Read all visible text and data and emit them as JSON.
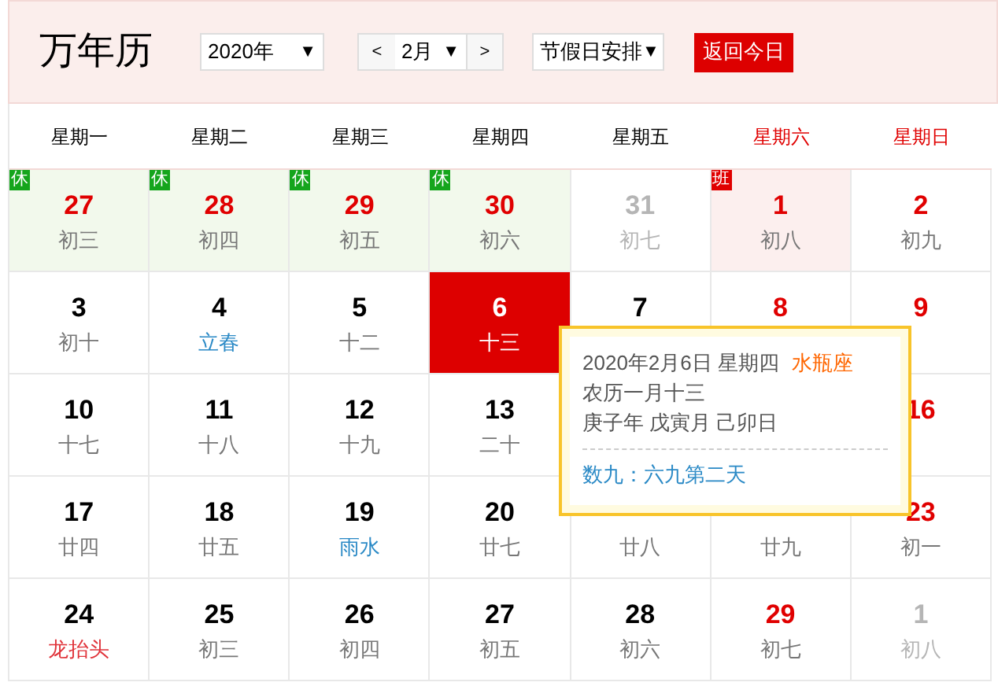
{
  "title": "万年历",
  "year_select": {
    "value": "2020年",
    "caret": "▼"
  },
  "month_select": {
    "prev": "<",
    "value": "2月",
    "caret": "▼",
    "next": ">"
  },
  "holiday_select": {
    "value": "节假日安排",
    "caret": "▼"
  },
  "today_button": "返回今日",
  "weekdays": [
    {
      "label": "星期一",
      "weekend": false
    },
    {
      "label": "星期二",
      "weekend": false
    },
    {
      "label": "星期三",
      "weekend": false
    },
    {
      "label": "星期四",
      "weekend": false
    },
    {
      "label": "星期五",
      "weekend": false
    },
    {
      "label": "星期六",
      "weekend": true
    },
    {
      "label": "星期日",
      "weekend": true
    }
  ],
  "cells": [
    {
      "date": "27",
      "kind": "rest",
      "lunar": {
        "text": "初三",
        "kind": "plain"
      },
      "badge": {
        "label": "休",
        "kind": "rest"
      },
      "selected": false
    },
    {
      "date": "28",
      "kind": "rest",
      "lunar": {
        "text": "初四",
        "kind": "plain"
      },
      "badge": {
        "label": "休",
        "kind": "rest"
      },
      "selected": false
    },
    {
      "date": "29",
      "kind": "rest",
      "lunar": {
        "text": "初五",
        "kind": "plain"
      },
      "badge": {
        "label": "休",
        "kind": "rest"
      },
      "selected": false
    },
    {
      "date": "30",
      "kind": "rest",
      "lunar": {
        "text": "初六",
        "kind": "plain"
      },
      "badge": {
        "label": "休",
        "kind": "rest"
      },
      "selected": false
    },
    {
      "date": "31",
      "kind": "muted",
      "lunar": {
        "text": "初七",
        "kind": "muted"
      },
      "selected": false
    },
    {
      "date": "1",
      "kind": "rest",
      "lunar": {
        "text": "初八",
        "kind": "plain"
      },
      "badge": {
        "label": "班",
        "kind": "work"
      },
      "selected": false
    },
    {
      "date": "2",
      "kind": "rest",
      "lunar": {
        "text": "初九",
        "kind": "plain"
      },
      "selected": false
    },
    {
      "date": "3",
      "kind": "work",
      "lunar": {
        "text": "初十",
        "kind": "plain"
      },
      "selected": false
    },
    {
      "date": "4",
      "kind": "work",
      "lunar": {
        "text": "立春",
        "kind": "term"
      },
      "selected": false
    },
    {
      "date": "5",
      "kind": "work",
      "lunar": {
        "text": "十二",
        "kind": "plain"
      },
      "selected": false
    },
    {
      "date": "6",
      "lunar": {
        "text": "十三"
      },
      "selected": true
    },
    {
      "date": "7",
      "kind": "work",
      "selected": false
    },
    {
      "date": "8",
      "kind": "rest",
      "selected": false
    },
    {
      "date": "9",
      "kind": "rest",
      "selected": false
    },
    {
      "date": "10",
      "kind": "work",
      "lunar": {
        "text": "十七",
        "kind": "plain"
      },
      "selected": false
    },
    {
      "date": "11",
      "kind": "work",
      "lunar": {
        "text": "十八",
        "kind": "plain"
      },
      "selected": false
    },
    {
      "date": "12",
      "kind": "work",
      "lunar": {
        "text": "十九",
        "kind": "plain"
      },
      "selected": false
    },
    {
      "date": "13",
      "kind": "work",
      "lunar": {
        "text": "二十",
        "kind": "plain"
      },
      "selected": false
    },
    {},
    {},
    {
      "date": "16",
      "kind": "rest",
      "selected": false
    },
    {
      "date": "17",
      "kind": "work",
      "lunar": {
        "text": "廿四",
        "kind": "plain"
      },
      "selected": false
    },
    {
      "date": "18",
      "kind": "work",
      "lunar": {
        "text": "廿五",
        "kind": "plain"
      },
      "selected": false
    },
    {
      "date": "19",
      "kind": "work",
      "lunar": {
        "text": "雨水",
        "kind": "term"
      },
      "selected": false
    },
    {
      "date": "20",
      "kind": "work",
      "lunar": {
        "text": "廿七",
        "kind": "plain"
      },
      "selected": false
    },
    {
      "lunar": {
        "text": "廿八",
        "kind": "plain"
      },
      "selected": false
    },
    {
      "lunar": {
        "text": "廿九",
        "kind": "plain"
      },
      "selected": false
    },
    {
      "date": "23",
      "kind": "rest",
      "lunar": {
        "text": "初一",
        "kind": "plain"
      },
      "selected": false
    },
    {
      "date": "24",
      "kind": "work",
      "lunar": {
        "text": "龙抬头",
        "kind": "festival"
      },
      "selected": false
    },
    {
      "date": "25",
      "kind": "work",
      "lunar": {
        "text": "初三",
        "kind": "plain"
      },
      "selected": false
    },
    {
      "date": "26",
      "kind": "work",
      "lunar": {
        "text": "初四",
        "kind": "plain"
      },
      "selected": false
    },
    {
      "date": "27",
      "kind": "work",
      "lunar": {
        "text": "初五",
        "kind": "plain"
      },
      "selected": false
    },
    {
      "date": "28",
      "kind": "work",
      "lunar": {
        "text": "初六",
        "kind": "plain"
      },
      "selected": false
    },
    {
      "date": "29",
      "kind": "rest",
      "lunar": {
        "text": "初七",
        "kind": "plain"
      },
      "selected": false
    },
    {
      "date": "1",
      "kind": "muted",
      "lunar": {
        "text": "初八",
        "kind": "muted"
      },
      "selected": false
    }
  ],
  "tooltip": {
    "date": "2020年2月6日 星期四",
    "zodiac": "水瓶座",
    "lunar": "农历一月十三",
    "ganzhi": "庚子年 戊寅月 己卯日",
    "shujiu": "数九：六九第二天"
  }
}
